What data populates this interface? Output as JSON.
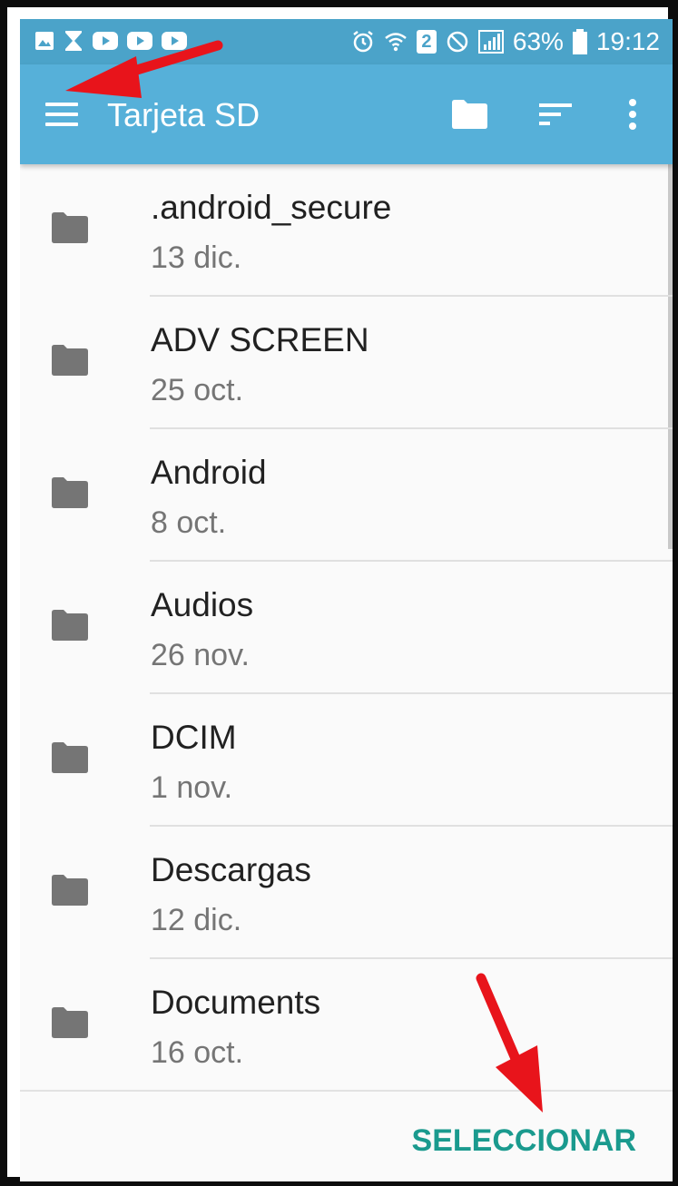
{
  "status_bar": {
    "battery_percent": "63%",
    "time": "19:12",
    "sim_badge": "2",
    "left_icons": [
      "gallery-icon",
      "hourglass-icon",
      "youtube-icon",
      "youtube-icon",
      "youtube-icon"
    ],
    "right_icons": [
      "alarm-icon",
      "wifi-icon",
      "sim-icon",
      "do-not-disturb-icon",
      "signal-icon",
      "battery-icon"
    ]
  },
  "app_bar": {
    "title": "Tarjeta SD",
    "icons": [
      "menu-icon",
      "folder-icon",
      "sort-icon",
      "more-vert-icon"
    ],
    "color": "#56b0d9"
  },
  "files": [
    {
      "name": ".android_secure",
      "date": "13 dic."
    },
    {
      "name": "ADV SCREEN",
      "date": "25 oct."
    },
    {
      "name": "Android",
      "date": "8 oct."
    },
    {
      "name": "Audios",
      "date": "26 nov."
    },
    {
      "name": "DCIM",
      "date": "1 nov."
    },
    {
      "name": "Descargas",
      "date": "12 dic."
    },
    {
      "name": "Documents",
      "date": "16 oct."
    }
  ],
  "bottom_bar": {
    "select_label": "SELECCIONAR",
    "accent": "#1a9a8e"
  },
  "annotation_color": "#e8141b"
}
